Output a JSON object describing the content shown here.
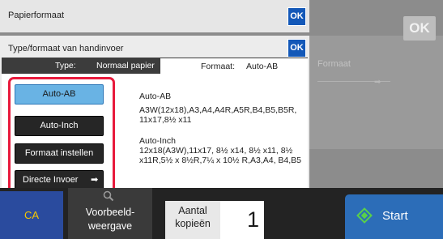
{
  "background": {
    "ok_label": "OK",
    "right_panel_text": "Formaat"
  },
  "dialog_paper": {
    "title": "Papierformaat",
    "ok_label": "OK"
  },
  "dialog_manual": {
    "title": "Type/formaat van handinvoer",
    "ok_label": "OK",
    "tab_type_label": "Type:",
    "tab_type_value": "Normaal papier",
    "tab_format_label": "Formaat:",
    "tab_format_value": "Auto-AB"
  },
  "options": [
    {
      "label": "Auto-AB",
      "selected": true
    },
    {
      "label": "Auto-Inch",
      "selected": false
    },
    {
      "label": "Formaat instellen",
      "selected": false
    },
    {
      "label": "Directe Invoer",
      "selected": false
    }
  ],
  "descriptions": {
    "auto_ab_title": "Auto-AB",
    "auto_ab_text": "A3W(12x18),A3,A4,A4R,A5R,B4,B5,B5R, 11x17,8½ x11",
    "auto_inch_title": "Auto-Inch",
    "auto_inch_text": "12x18(A3W),11x17, 8½ x14, 8½ x11, 8½ x11R,5½ x 8½R,7¼ x 10½ R,A3,A4, B4,B5"
  },
  "bottom": {
    "ca_label": "CA",
    "preview_line1": "Voorbeeld-",
    "preview_line2": "weergave",
    "copies_line1": "Aantal",
    "copies_line2": "kopieën",
    "copies_value": "1",
    "start_label": "Start"
  },
  "colors": {
    "ok_blue": "#1358b8",
    "highlight_red": "#e81a3c",
    "selected_option": "#69b3e4",
    "ca_background": "#2a4b9e",
    "ca_text": "#f5c800",
    "start_background": "#2c6db8",
    "start_icon": "#59d049"
  },
  "icons": {
    "preview": "magnifier-icon",
    "direct_input_arrow": "arrow-right-icon",
    "start": "diamond-start-icon"
  }
}
